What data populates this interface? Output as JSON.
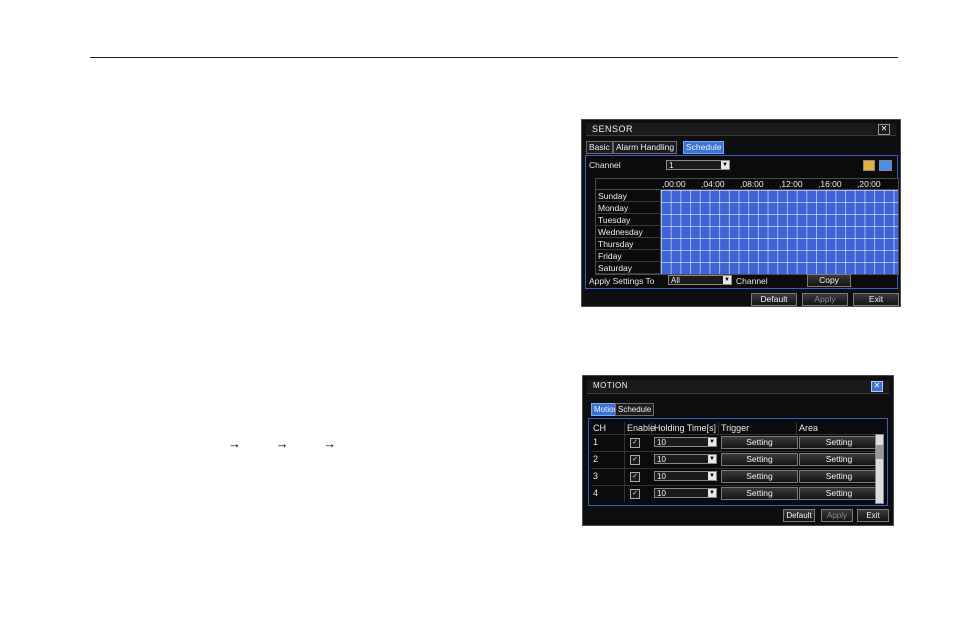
{
  "arrows": [
    "→",
    "→",
    "→"
  ],
  "sensor": {
    "title": "SENSOR",
    "close_glyph": "✕",
    "tabs": [
      "Basic",
      "Alarm Handling",
      "Schedule"
    ],
    "channel_label": "Channel",
    "channel_value": "1",
    "hours": [
      ",00:00",
      ",04:00",
      ",08:00",
      ",12:00",
      ",16:00",
      ",20:00"
    ],
    "days": [
      "Sunday",
      "Monday",
      "Tuesday",
      "Wednesday",
      "Thursday",
      "Friday",
      "Saturday"
    ],
    "apply_label": "Apply Settings To",
    "apply_value": "All",
    "channel_word": "Channel",
    "copy_label": "Copy",
    "default_label": "Default",
    "apply_button": "Apply",
    "exit_label": "Exit",
    "grid_color": "#3f64d6"
  },
  "motion": {
    "title": "MOTION",
    "close_glyph": "✕",
    "tabs": [
      "Motion",
      "Schedule"
    ],
    "columns": [
      "CH",
      "Enable",
      "Holding Time[s]",
      "Trigger",
      "Area"
    ],
    "rows": [
      {
        "ch": "1",
        "enabled": "✓",
        "holding": "10",
        "trigger": "Setting",
        "area": "Setting"
      },
      {
        "ch": "2",
        "enabled": "✓",
        "holding": "10",
        "trigger": "Setting",
        "area": "Setting"
      },
      {
        "ch": "3",
        "enabled": "✓",
        "holding": "10",
        "trigger": "Setting",
        "area": "Setting"
      },
      {
        "ch": "4",
        "enabled": "✓",
        "holding": "10",
        "trigger": "Setting",
        "area": "Setting"
      }
    ],
    "default_label": "Default",
    "apply_button": "Apply",
    "exit_label": "Exit"
  }
}
